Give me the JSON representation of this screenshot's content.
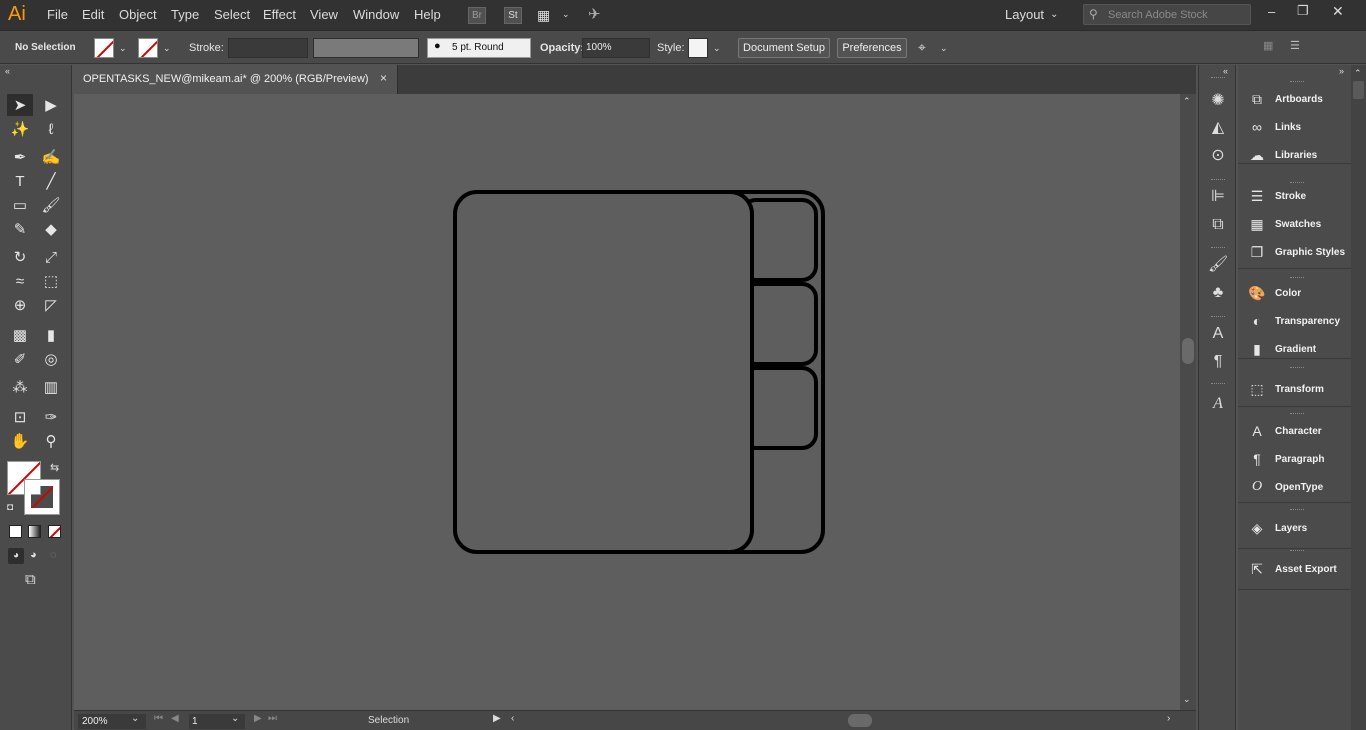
{
  "app": {
    "logo": "Ai"
  },
  "menu": {
    "items": [
      "File",
      "Edit",
      "Object",
      "Type",
      "Select",
      "Effect",
      "View",
      "Window",
      "Help"
    ],
    "bridge": "Br",
    "stock": "St",
    "workspace": "Layout",
    "search_placeholder": "Search Adobe Stock"
  },
  "control_bar": {
    "selection": "No Selection",
    "stroke_label": "Stroke:",
    "brush": "5 pt. Round",
    "opacity_label": "Opacity:",
    "opacity_value": "100%",
    "style_label": "Style:",
    "document_setup": "Document Setup",
    "preferences": "Preferences"
  },
  "document": {
    "tab_title": "OPENTASKS_NEW@mikeam.ai* @ 200% (RGB/Preview)",
    "close": "×"
  },
  "status_bar": {
    "zoom": "200%",
    "page": "1",
    "mode": "Selection"
  },
  "panels": {
    "group1": [
      "Artboards",
      "Links",
      "Libraries"
    ],
    "group2": [
      "Stroke",
      "Swatches",
      "Graphic Styles"
    ],
    "group3": [
      "Color",
      "Transparency",
      "Gradient"
    ],
    "group4": [
      "Transform"
    ],
    "group5": [
      "Character",
      "Paragraph",
      "OpenType"
    ],
    "group6": [
      "Layers"
    ],
    "group7": [
      "Asset Export"
    ]
  },
  "colors": {
    "canvas": "#5e5e5e",
    "artwork_stroke": "#000000",
    "logo": "#ff9a00"
  }
}
